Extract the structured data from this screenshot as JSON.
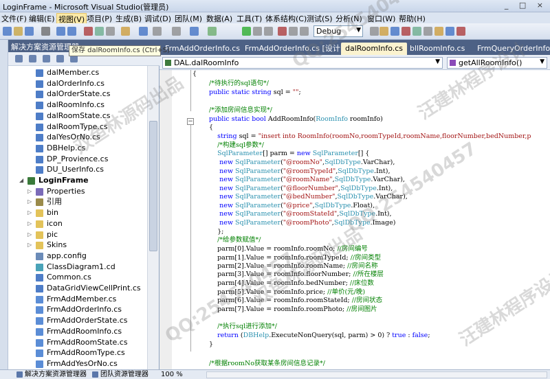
{
  "window": {
    "title": "LoginFrame - Microsoft Visual Studio(管理员)",
    "buttons": "_ □ ×"
  },
  "menu": [
    "文件(F)",
    "编辑(E)",
    "视图(V)",
    "项目(P)",
    "生成(B)",
    "调试(D)",
    "团队(M)",
    "数据(A)",
    "工具(T)",
    "体系结构(C)",
    "测试(S)",
    "分析(N)",
    "窗口(W)",
    "帮助(H)"
  ],
  "toolbar": {
    "config": "Debug"
  },
  "solution_explorer": {
    "header": "解决方案资源管理器",
    "tooltip": "保存 dalRoomInfo.cs (Ctrl+S)",
    "items": [
      {
        "label": "dalMember.cs",
        "icon": "csharp-file-icon"
      },
      {
        "label": "dalOrderInfo.cs",
        "icon": "csharp-file-icon"
      },
      {
        "label": "dalOrderState.cs",
        "icon": "csharp-file-icon"
      },
      {
        "label": "dalRoomInfo.cs",
        "icon": "csharp-file-icon"
      },
      {
        "label": "dalRoomState.cs",
        "icon": "csharp-file-icon"
      },
      {
        "label": "dalRoomType.cs",
        "icon": "csharp-file-icon"
      },
      {
        "label": "dalYesOrNo.cs",
        "icon": "csharp-file-icon"
      },
      {
        "label": "DBHelp.cs",
        "icon": "csharp-file-icon"
      },
      {
        "label": "DP_Provience.cs",
        "icon": "csharp-file-icon"
      },
      {
        "label": "DU_UserInfo.cs",
        "icon": "csharp-file-icon"
      },
      {
        "label": "LoginFrame",
        "icon": "project-icon",
        "bold": true
      },
      {
        "label": "Properties",
        "icon": "properties-icon"
      },
      {
        "label": "引用",
        "icon": "references-icon"
      },
      {
        "label": "bin",
        "icon": "folder-icon"
      },
      {
        "label": "icon",
        "icon": "folder-icon"
      },
      {
        "label": "pic",
        "icon": "folder-icon"
      },
      {
        "label": "Skins",
        "icon": "folder-icon"
      },
      {
        "label": "app.config",
        "icon": "config-file-icon"
      },
      {
        "label": "ClassDiagram1.cd",
        "icon": "diagram-file-icon"
      },
      {
        "label": "Common.cs",
        "icon": "csharp-file-icon"
      },
      {
        "label": "DataGridViewCellPrint.cs",
        "icon": "csharp-file-icon"
      },
      {
        "label": "FrmAddMember.cs",
        "icon": "form-file-icon"
      },
      {
        "label": "FrmAddOrderInfo.cs",
        "icon": "form-file-icon"
      },
      {
        "label": "FrmAddOrderState.cs",
        "icon": "form-file-icon"
      },
      {
        "label": "FrmAddRoomInfo.cs",
        "icon": "form-file-icon"
      },
      {
        "label": "FrmAddRoomState.cs",
        "icon": "form-file-icon"
      },
      {
        "label": "FrmAddRoomType.cs",
        "icon": "form-file-icon"
      },
      {
        "label": "FrmAddYesOrNo.cs",
        "icon": "form-file-icon"
      }
    ]
  },
  "tabs": [
    {
      "label": "FrmAddOrderInfo.cs",
      "active": false
    },
    {
      "label": "FrmAddOrderInfo.cs [设计]",
      "active": false
    },
    {
      "label": "dalRoomInfo.cs",
      "active": true
    },
    {
      "label": "bllRoomInfo.cs",
      "active": false
    },
    {
      "label": "FrmQueryOrderInfo.cs",
      "active": false
    }
  ],
  "navigation": {
    "class_name": "DAL.dalRoomInfo",
    "method_name": "getAllRoomInfo()"
  },
  "code_lines": [
    [
      [
        "",
        "{"
      ]
    ],
    [
      [
        "cm",
        "/*待执行的sql语句*/"
      ]
    ],
    [
      [
        "kw",
        "public static string"
      ],
      [
        "",
        " sql = "
      ],
      [
        "str",
        "\"\""
      ],
      [
        "",
        ";"
      ]
    ],
    [],
    [
      [
        "cm",
        "/*添加房间信息实现*/"
      ]
    ],
    [
      [
        "kw",
        "public static bool"
      ],
      [
        "",
        " AddRoomInfo("
      ],
      [
        "ty",
        "RoomInfo"
      ],
      [
        "",
        " roomInfo)"
      ]
    ],
    [
      [
        "",
        "{"
      ]
    ],
    [
      [
        "kw",
        "    string"
      ],
      [
        "",
        " sql = "
      ],
      [
        "str",
        "\"insert into RoomInfo(roomNo,roomTypeId,roomName,floorNumber,bedNumber,p"
      ]
    ],
    [
      [
        "cm",
        "    /*构建sql参数*/"
      ]
    ],
    [
      [
        "ty",
        "    SqlParameter"
      ],
      [
        "",
        "[] parm = "
      ],
      [
        "kw",
        "new "
      ],
      [
        "ty",
        "SqlParameter"
      ],
      [
        "",
        "[] {"
      ]
    ],
    [
      [
        "kw",
        "     new "
      ],
      [
        "ty",
        "SqlParameter"
      ],
      [
        "",
        "("
      ],
      [
        "str",
        "\"@roomNo\""
      ],
      [
        "",
        ","
      ],
      [
        "ty",
        "SqlDbType"
      ],
      [
        "",
        ".VarChar),"
      ]
    ],
    [
      [
        "kw",
        "     new "
      ],
      [
        "ty",
        "SqlParameter"
      ],
      [
        "",
        "("
      ],
      [
        "str",
        "\"@roomTypeId\""
      ],
      [
        "",
        ","
      ],
      [
        "ty",
        "SqlDbType"
      ],
      [
        "",
        ".Int),"
      ]
    ],
    [
      [
        "kw",
        "     new "
      ],
      [
        "ty",
        "SqlParameter"
      ],
      [
        "",
        "("
      ],
      [
        "str",
        "\"@roomName\""
      ],
      [
        "",
        ","
      ],
      [
        "ty",
        "SqlDbType"
      ],
      [
        "",
        ".VarChar),"
      ]
    ],
    [
      [
        "kw",
        "     new "
      ],
      [
        "ty",
        "SqlParameter"
      ],
      [
        "",
        "("
      ],
      [
        "str",
        "\"@floorNumber\""
      ],
      [
        "",
        ","
      ],
      [
        "ty",
        "SqlDbType"
      ],
      [
        "",
        ".Int),"
      ]
    ],
    [
      [
        "kw",
        "     new "
      ],
      [
        "ty",
        "SqlParameter"
      ],
      [
        "",
        "("
      ],
      [
        "str",
        "\"@bedNumber\""
      ],
      [
        "",
        ","
      ],
      [
        "ty",
        "SqlDbType"
      ],
      [
        "",
        ".VarChar),"
      ]
    ],
    [
      [
        "kw",
        "     new "
      ],
      [
        "ty",
        "SqlParameter"
      ],
      [
        "",
        "("
      ],
      [
        "str",
        "\"@price\""
      ],
      [
        "",
        ","
      ],
      [
        "ty",
        "SqlDbType"
      ],
      [
        "",
        ".Float),"
      ]
    ],
    [
      [
        "kw",
        "     new "
      ],
      [
        "ty",
        "SqlParameter"
      ],
      [
        "",
        "("
      ],
      [
        "str",
        "\"@roomStateId\""
      ],
      [
        "",
        ","
      ],
      [
        "ty",
        "SqlDbType"
      ],
      [
        "",
        ".Int),"
      ]
    ],
    [
      [
        "kw",
        "     new "
      ],
      [
        "ty",
        "SqlParameter"
      ],
      [
        "",
        "("
      ],
      [
        "str",
        "\"@roomPhoto\""
      ],
      [
        "",
        ","
      ],
      [
        "ty",
        "SqlDbType"
      ],
      [
        "",
        ".Image)"
      ]
    ],
    [
      [
        "",
        "    };"
      ]
    ],
    [
      [
        "cm",
        "    /*给参数赋值*/"
      ]
    ],
    [
      [
        "",
        "    parm[0].Value = roomInfo.roomNo; "
      ],
      [
        "cm",
        "//房间编号"
      ]
    ],
    [
      [
        "",
        "    parm[1].Value = roomInfo.roomTypeId; "
      ],
      [
        "cm",
        "//房间类型"
      ]
    ],
    [
      [
        "",
        "    parm[2].Value = roomInfo.roomName; "
      ],
      [
        "cm",
        "//房间名称"
      ]
    ],
    [
      [
        "",
        "    parm[3].Value = roomInfo.floorNumber; "
      ],
      [
        "cm",
        "//所在楼层"
      ]
    ],
    [
      [
        "",
        "    parm[4].Value = roomInfo.bedNumber; "
      ],
      [
        "cm",
        "//床位数"
      ]
    ],
    [
      [
        "",
        "    parm[5].Value = roomInfo.price; "
      ],
      [
        "cm",
        "//单价(元/晚)"
      ]
    ],
    [
      [
        "",
        "    parm[6].Value = roomInfo.roomStateId; "
      ],
      [
        "cm",
        "//房间状态"
      ]
    ],
    [
      [
        "",
        "    parm[7].Value = roomInfo.roomPhoto; "
      ],
      [
        "cm",
        "//房间图片"
      ]
    ],
    [],
    [
      [
        "cm",
        "    /*执行sql进行添加*/"
      ]
    ],
    [
      [
        "kw",
        "    return"
      ],
      [
        "",
        " ("
      ],
      [
        "ty",
        "DBHelp"
      ],
      [
        "",
        ".ExecuteNonQuery(sql, parm) > 0) ? "
      ],
      [
        "kw",
        "true"
      ],
      [
        "",
        " : "
      ],
      [
        "kw",
        "false"
      ],
      [
        "",
        ";"
      ]
    ],
    [
      [
        "",
        "}"
      ]
    ],
    [],
    [
      [
        "cm",
        "/*根据roomNo获取某条房间信息记录*/"
      ]
    ]
  ],
  "statusbar": {
    "solution_tab": "解决方案资源管理器",
    "team_tab": "团队资源管理器",
    "zoom": "100 %"
  },
  "watermarks": [
    "QQ:254540457",
    "双鱼林源码出品",
    "汪建林程序设计"
  ]
}
